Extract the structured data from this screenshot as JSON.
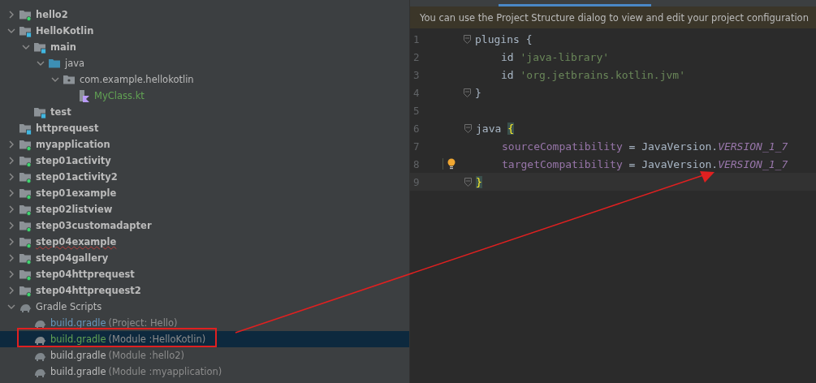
{
  "project_tree": [
    {
      "label": "hello2",
      "kind": "android-module",
      "expanded": false
    },
    {
      "label": "HelloKotlin",
      "kind": "java-module",
      "expanded": true,
      "children": [
        {
          "label": "main",
          "kind": "source-set",
          "expanded": true,
          "children": [
            {
              "label": "java",
              "kind": "source-folder",
              "expanded": true,
              "children": [
                {
                  "label": "com.example.hellokotlin",
                  "kind": "package",
                  "expanded": true,
                  "children": [
                    {
                      "label": "MyClass.kt",
                      "kind": "kotlin-file",
                      "color": "#62a354"
                    }
                  ]
                }
              ]
            }
          ]
        },
        {
          "label": "test",
          "kind": "source-set"
        }
      ]
    },
    {
      "label": "httprequest",
      "kind": "java-module"
    },
    {
      "label": "myapplication",
      "kind": "android-module",
      "expanded": false
    },
    {
      "label": "step01activity",
      "kind": "android-module",
      "expanded": false
    },
    {
      "label": "step01activity2",
      "kind": "android-module",
      "expanded": false
    },
    {
      "label": "step01example",
      "kind": "android-module",
      "expanded": false
    },
    {
      "label": "step02listview",
      "kind": "android-module",
      "expanded": false
    },
    {
      "label": "step03customadapter",
      "kind": "android-module",
      "expanded": false
    },
    {
      "label": "step04example",
      "kind": "android-module",
      "expanded": false,
      "typo": true
    },
    {
      "label": "step04gallery",
      "kind": "android-module",
      "expanded": false
    },
    {
      "label": "step04httprequest",
      "kind": "android-module",
      "expanded": false
    },
    {
      "label": "step04httprequest2",
      "kind": "android-module",
      "expanded": false
    },
    {
      "label": "Gradle Scripts",
      "kind": "gradle-group",
      "expanded": true,
      "children": [
        {
          "label": "build.gradle",
          "qualifier": "(Project: Hello)",
          "kind": "gradle-file",
          "color": "#6897bb",
          "selected": false
        },
        {
          "label": "build.gradle",
          "qualifier": "(Module :HelloKotlin)",
          "kind": "gradle-file",
          "color": "#62a354",
          "selected": true
        },
        {
          "label": "build.gradle",
          "qualifier": "(Module :hello2)",
          "kind": "gradle-file",
          "selected": false
        },
        {
          "label": "build.gradle",
          "qualifier": "(Module :myapplication)",
          "kind": "gradle-file",
          "selected": false
        }
      ]
    }
  ],
  "editor": {
    "notification": "You can use the Project Structure dialog to view and edit your project configuration",
    "lines": [
      {
        "number": "1",
        "fold": true,
        "tokens": [
          {
            "kind": "plain",
            "text": "plugins "
          },
          {
            "kind": "brace",
            "text": "{"
          }
        ]
      },
      {
        "number": "2",
        "indented": true,
        "tokens": [
          {
            "kind": "plain",
            "text": "id "
          },
          {
            "kind": "string",
            "text": "'java-library'"
          }
        ]
      },
      {
        "number": "3",
        "indented": true,
        "tokens": [
          {
            "kind": "plain",
            "text": "id "
          },
          {
            "kind": "string",
            "text": "'org.jetbrains.kotlin.jvm'"
          }
        ]
      },
      {
        "number": "4",
        "fold": true,
        "tokens": [
          {
            "kind": "brace",
            "text": "}"
          }
        ]
      },
      {
        "number": "5"
      },
      {
        "number": "6",
        "fold": true,
        "tokens": [
          {
            "kind": "plain",
            "text": "java "
          },
          {
            "kind": "brace-match",
            "text": "{"
          }
        ]
      },
      {
        "number": "7",
        "indented": true,
        "tokens": [
          {
            "kind": "field",
            "text": "sourceCompatibility"
          },
          {
            "kind": "plain",
            "text": " = JavaVersion."
          },
          {
            "kind": "constant",
            "text": "VERSION_1_7"
          }
        ]
      },
      {
        "number": "8",
        "indented": true,
        "bulb": true,
        "tokens": [
          {
            "kind": "field",
            "text": "targetCompatibility"
          },
          {
            "kind": "plain",
            "text": " = JavaVersion."
          },
          {
            "kind": "constant",
            "text": "VERSION_1_7"
          }
        ]
      },
      {
        "number": "9",
        "fold": true,
        "current": true,
        "tokens": [
          {
            "kind": "brace-match",
            "text": "}"
          }
        ]
      }
    ]
  }
}
